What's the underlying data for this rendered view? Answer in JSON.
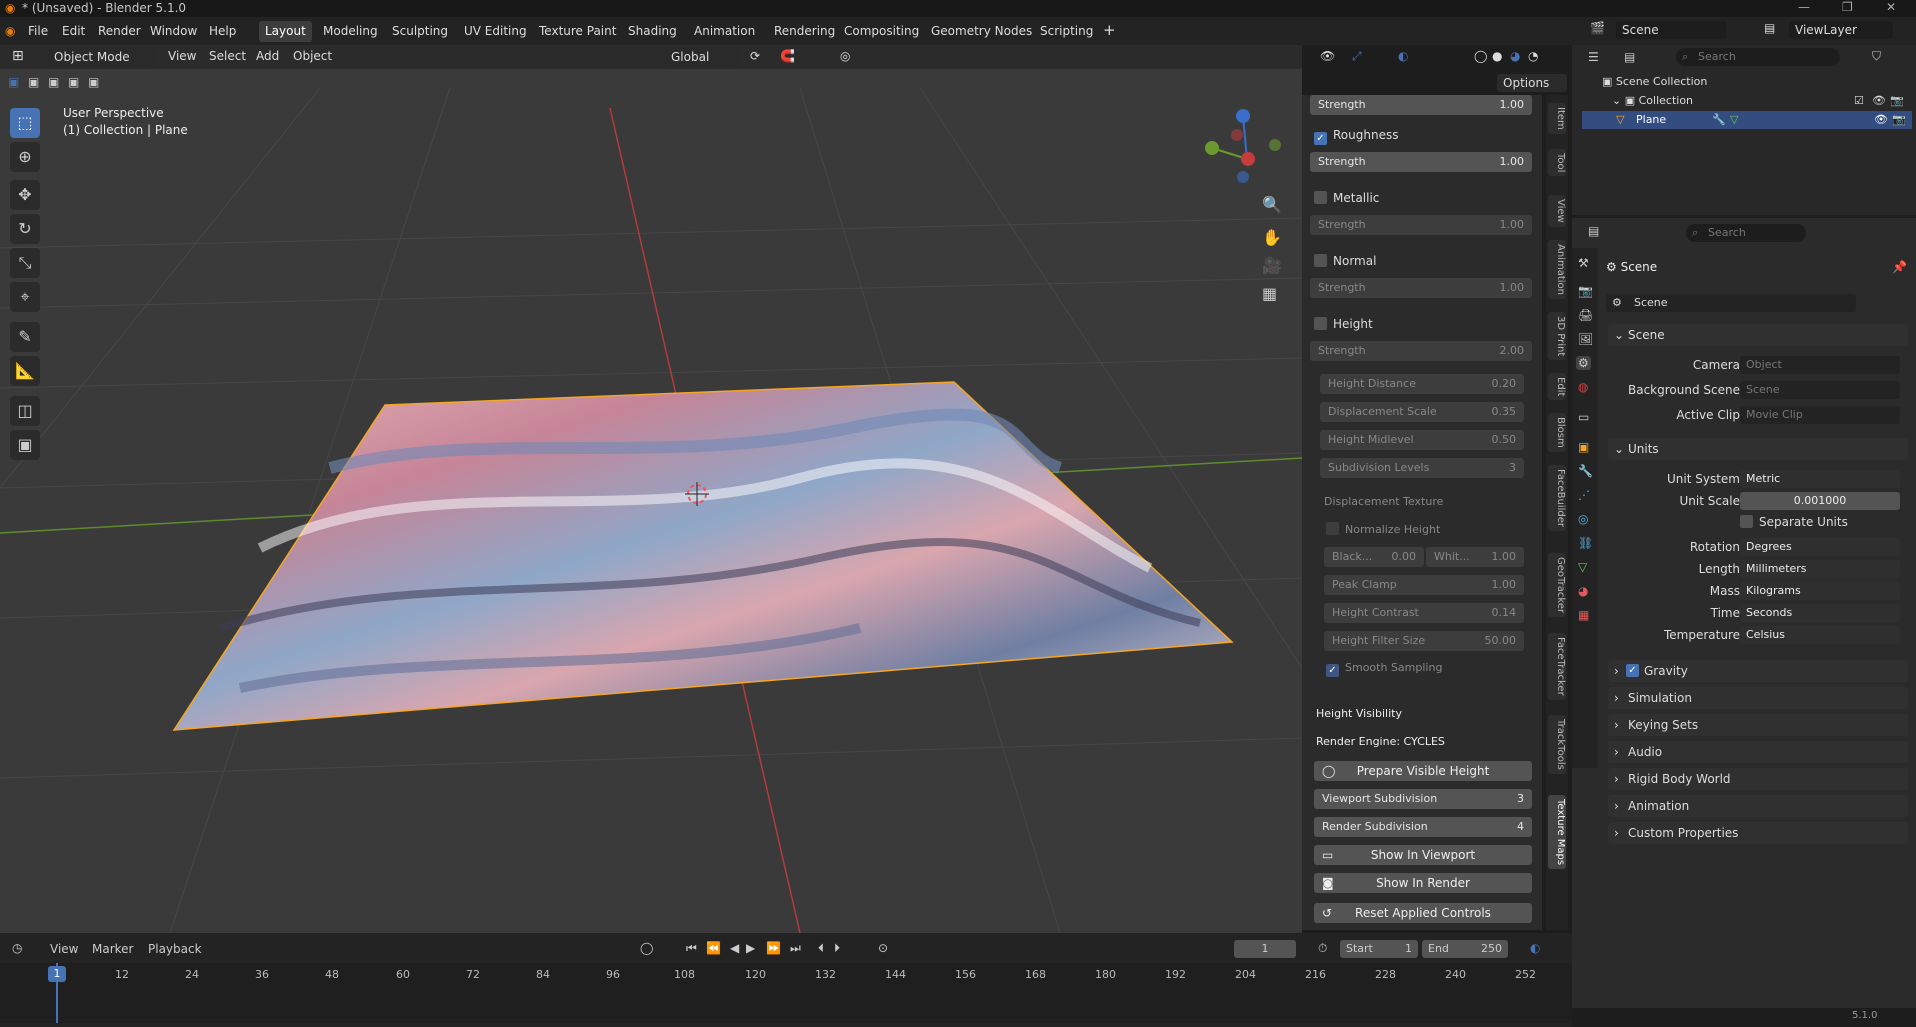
{
  "window": {
    "title": "* (Unsaved) - Blender 5.1.0",
    "version": "5.1.0"
  },
  "menu": [
    "File",
    "Edit",
    "Render",
    "Window",
    "Help"
  ],
  "workspaces": [
    "Layout",
    "Modeling",
    "Sculpting",
    "UV Editing",
    "Texture Paint",
    "Shading",
    "Animation",
    "Rendering",
    "Compositing",
    "Geometry Nodes",
    "Scripting"
  ],
  "active_workspace": "Layout",
  "scene": {
    "name": "Scene",
    "view_layer": "ViewLayer"
  },
  "viewport_header": {
    "mode": "Object Mode",
    "menus": [
      "View",
      "Select",
      "Add",
      "Object"
    ],
    "orientation": "Global",
    "options": "Options"
  },
  "viewport": {
    "perspective": "User Perspective",
    "collection": "(1) Collection | Plane"
  },
  "npanel": {
    "top_strength": {
      "label": "Strength",
      "value": "1.00"
    },
    "maps": [
      {
        "name": "Roughness",
        "checked": true,
        "strength": "1.00"
      },
      {
        "name": "Metallic",
        "checked": false,
        "strength": "1.00"
      },
      {
        "name": "Normal",
        "checked": false,
        "strength": "1.00"
      },
      {
        "name": "Height",
        "checked": false,
        "strength": "2.00"
      }
    ],
    "strength_label": "Strength",
    "height_params": [
      {
        "label": "Height Distance",
        "value": "0.20"
      },
      {
        "label": "Displacement Scale",
        "value": "0.35"
      },
      {
        "label": "Height Midlevel",
        "value": "0.50"
      },
      {
        "label": "Subdivision Levels",
        "value": "3"
      }
    ],
    "displacement_texture": "Displacement Texture",
    "normalize_height": "Normalize Height",
    "black": {
      "label": "Black...",
      "value": "0.00"
    },
    "white": {
      "label": "Whit...",
      "value": "1.00"
    },
    "tex_params": [
      {
        "label": "Peak Clamp",
        "value": "1.00"
      },
      {
        "label": "Height Contrast",
        "value": "0.14"
      },
      {
        "label": "Height Filter Size",
        "value": "50.00"
      }
    ],
    "smooth_sampling": "Smooth Sampling",
    "height_visibility": "Height Visibility",
    "render_engine": "Render Engine: CYCLES",
    "prepare_button": "Prepare Visible Height",
    "viewport_subdivision": {
      "label": "Viewport Subdivision",
      "value": "3"
    },
    "render_subdivision": {
      "label": "Render Subdivision",
      "value": "4"
    },
    "show_viewport": "Show In Viewport",
    "show_render": "Show In Render",
    "reset": "Reset Applied Controls"
  },
  "side_tabs": [
    "Item",
    "Tool",
    "View",
    "Animation",
    "3D Print",
    "Edit",
    "Blosm",
    "FaceBuilder",
    "GeoTracker",
    "FaceTracker",
    "TrackTools",
    "Texture Maps"
  ],
  "outliner": {
    "search_placeholder": "Search",
    "root": "Scene Collection",
    "collection": "Collection",
    "object": "Plane"
  },
  "properties": {
    "search_placeholder": "Search",
    "context": "Scene",
    "scene_field": "Scene",
    "scene_section": "Scene",
    "camera": {
      "label": "Camera",
      "value": "Object"
    },
    "background": {
      "label": "Background Scene",
      "value": "Scene"
    },
    "clip": {
      "label": "Active Clip",
      "value": "Movie Clip"
    },
    "units_section": "Units",
    "unit_system": {
      "label": "Unit System",
      "value": "Metric"
    },
    "unit_scale": {
      "label": "Unit Scale",
      "value": "0.001000"
    },
    "separate_units": "Separate Units",
    "rotation": {
      "label": "Rotation",
      "value": "Degrees"
    },
    "length": {
      "label": "Length",
      "value": "Millimeters"
    },
    "mass": {
      "label": "Mass",
      "value": "Kilograms"
    },
    "time": {
      "label": "Time",
      "value": "Seconds"
    },
    "temperature": {
      "label": "Temperature",
      "value": "Celsius"
    },
    "collapsed": [
      "Gravity",
      "Simulation",
      "Keying Sets",
      "Audio",
      "Rigid Body World",
      "Animation",
      "Custom Properties"
    ]
  },
  "timeline": {
    "menus": [
      "View",
      "Marker",
      "Playback"
    ],
    "current_frame": "1",
    "start_label": "Start",
    "start": "1",
    "end_label": "End",
    "end": "250",
    "ticks": [
      "1",
      "12",
      "24",
      "36",
      "48",
      "60",
      "72",
      "84",
      "96",
      "108",
      "120",
      "132",
      "144",
      "156",
      "168",
      "180",
      "192",
      "204",
      "216",
      "228",
      "240",
      "252"
    ]
  },
  "colors": {
    "accent": "#4772b3",
    "selection": "#f5a623",
    "x_axis": "#c43c3c",
    "y_axis": "#6a9a2f",
    "z_axis": "#3a6ec8"
  },
  "icons": [
    "blender-logo-icon",
    "cursor-icon",
    "move-icon",
    "rotate-icon",
    "scale-icon",
    "transform-icon",
    "annotate-icon",
    "measure-icon",
    "add-cube-icon",
    "zoom-icon",
    "hand-icon",
    "camera-icon",
    "grid-icon",
    "eye-icon",
    "camera-render-icon",
    "wrench-icon",
    "search-icon",
    "filter-icon"
  ]
}
